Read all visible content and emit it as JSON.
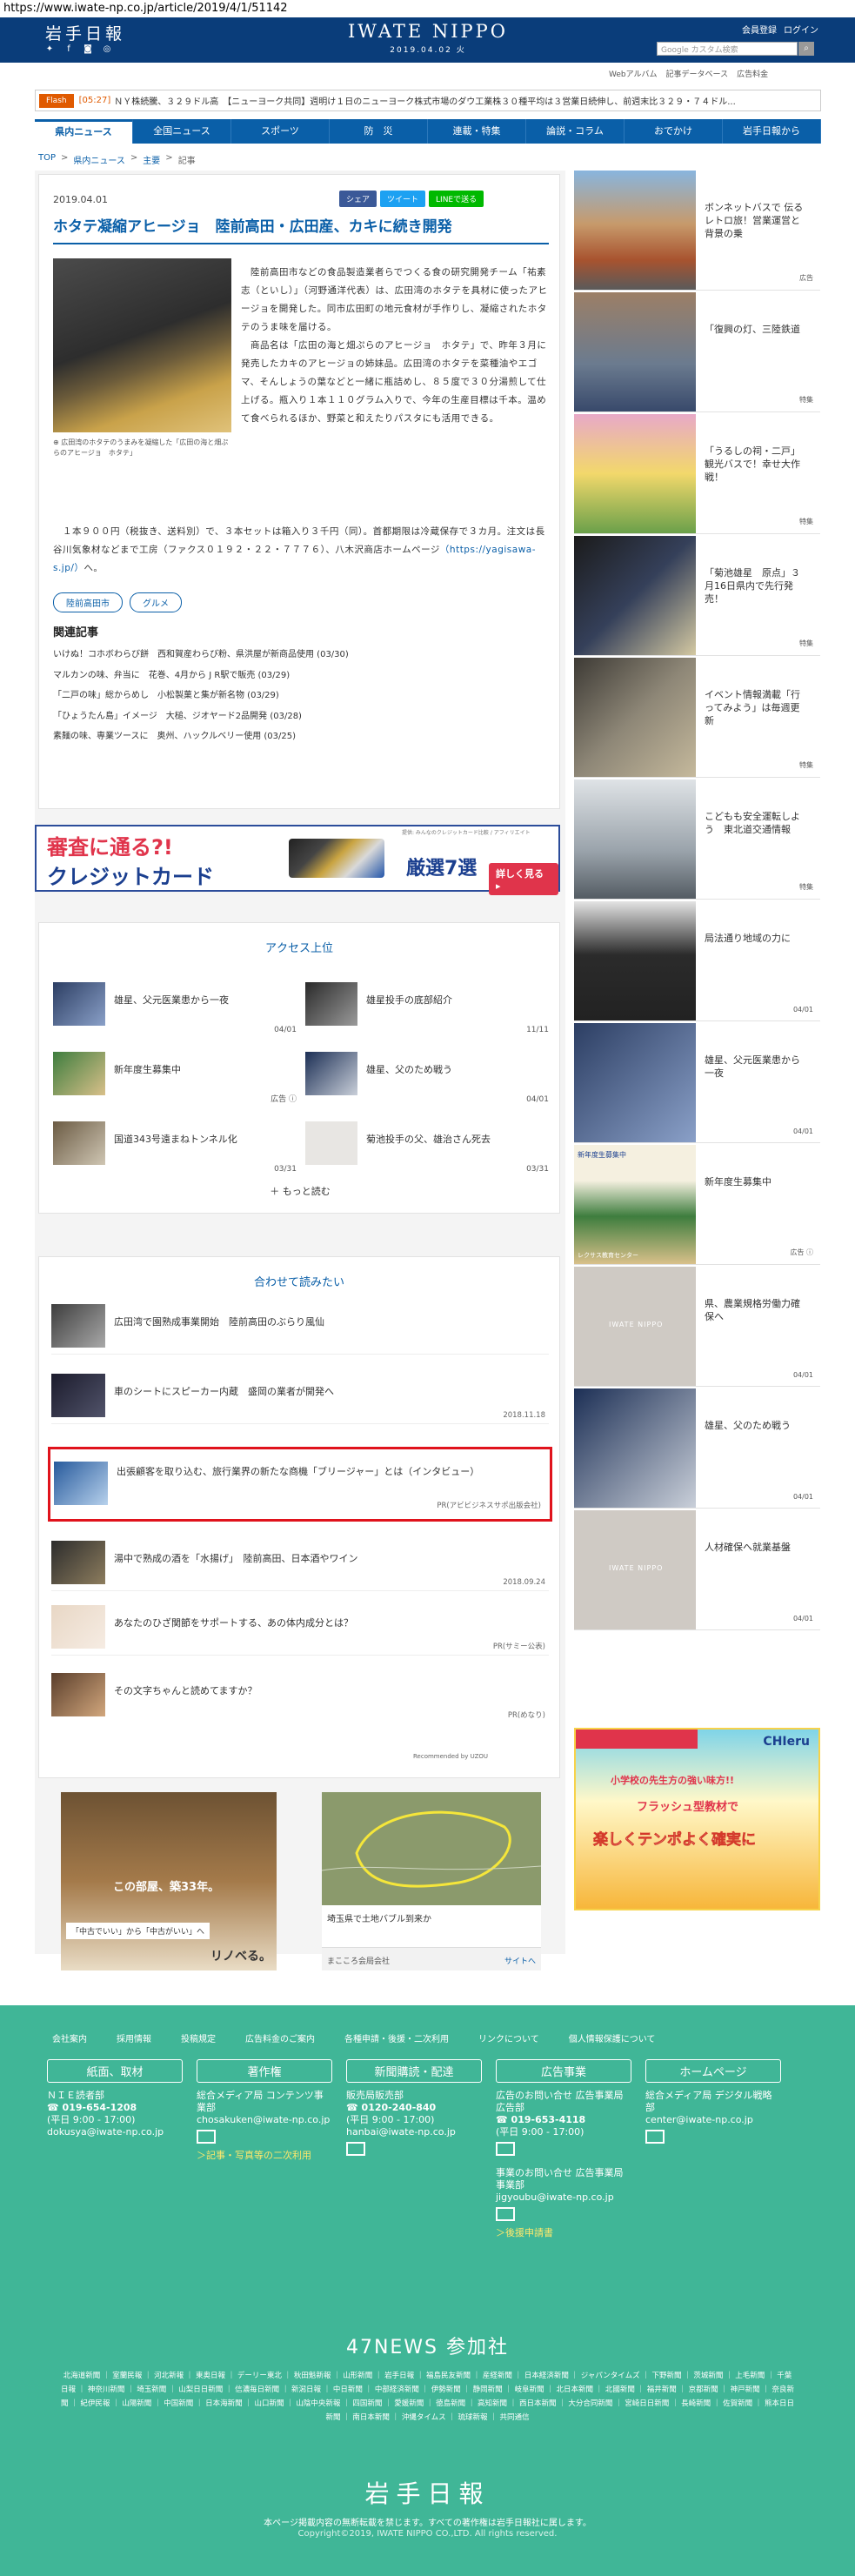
{
  "url": "https://www.iwate-np.co.jp/article/2019/4/1/51142",
  "header": {
    "logo_jp": "岩手日報",
    "brand": "IWATE NIPPO",
    "date": "2019.04.02 火",
    "links": [
      "会員登録",
      "ログイン"
    ],
    "search_placeholder": "Google カスタム検索",
    "social": [
      "twitter-icon",
      "facebook-icon",
      "line-icon",
      "instagram-icon"
    ]
  },
  "subnav": [
    "Webアルバム",
    "記事データベース",
    "広告料金"
  ],
  "ticker": {
    "label": "Flash",
    "time": "[05:27]",
    "text": "ＮＹ株続騰、３２９ドル高　【ニューヨーク共同】週明け１日のニューヨーク株式市場のダウ工業株３０種平均は３営業日続伸し、前週末比３２９・７４ドル..."
  },
  "nav": [
    "県内ニュース",
    "全国ニュース",
    "スポーツ",
    "防　災",
    "連載・特集",
    "論説・コラム",
    "おでかけ",
    "岩手日報から"
  ],
  "breadcrumb": [
    "TOP",
    "県内ニュース",
    "主要",
    "記事"
  ],
  "article": {
    "date": "2019.04.01",
    "share": [
      "シェア",
      "ツイート",
      "LINEで送る"
    ],
    "title": "ホタテ凝縮アヒージョ　陸前高田・広田産、カキに続き開発",
    "caption": "広田湾のホタテのうまみを凝縮した「広田の海と畑ぷらのアヒージョ　ホタテ」",
    "para1": "　陸前高田市などの食品製造業者らでつくる食の研究開発チーム「祐素志（といし）」（河野通洋代表）は、広田湾のホタテを具材に使ったアヒージョを開発した。同市広田町の地元食材が手作りし、凝縮されたホタテのうま味を届ける。",
    "para2": "　商品名は「広田の海と畑ぷらのアヒージョ　ホタテ」で、昨年３月に発売したカキのアヒージョの姉妹品。広田湾のホタテを菜種油やエゴマ、そんしょうの葉などと一緒に瓶詰めし、８５度で３０分湯煎して仕上げる。瓶入り１本１１０グラム入りで、今年の生産目標は千本。温めて食べられるほか、野菜と和えたりパスタにも活用できる。",
    "para3": "　１本９００円（税抜き、送料別）で、３本セットは箱入り３千円（同）。首都期限は冷蔵保存で３カ月。注文は長谷川気象材などまで工房（ファクス０１９２・２２・７７７６）、八木沢商店ホームページ",
    "link": "（https://yagisawa-s.jp/）",
    "para3_end": "へ。",
    "tags": [
      "陸前高田市",
      "グルメ"
    ],
    "related_heading": "関連記事",
    "related": [
      "いけぬ！コホボわらび餅　西和賀産わらび粉、県洪屋が新商品使用 (03/30)",
      "マルカンの味、弁当に　花巻、4月から J R駅で販売 (03/29)",
      "「二戸の味」総からめし　小松製菓と集が新名物 (03/29)",
      "「ひょうたん島」イメージ　大槌、ジオヤード2品開発 (03/28)",
      "素麺の味、専業ツースに　奥州、ハックルベリー使用 (03/25)"
    ]
  },
  "banner_ad": {
    "top": "提供: みんなのクレジットカード比較 / アフィリエイト",
    "line1": "審査に通る?!",
    "line2": "クレジットカード",
    "highlight": "厳選7選",
    "button": "詳しく見る ▸"
  },
  "ranking": {
    "title": "アクセス上位",
    "items": [
      {
        "text": "雄星、父元医業患から一夜",
        "date": "04/01"
      },
      {
        "text": "雄星投手の底部紹介",
        "date": "11/11"
      },
      {
        "text": "新年度生募集中",
        "date": "広告 ⓘ"
      },
      {
        "text": "雄星、父のため戦う",
        "date": "04/01"
      },
      {
        "text": "国道343号遠まねトンネル化",
        "date": "03/31"
      },
      {
        "text": "菊池投手の父、雄治さん死去",
        "date": "03/31"
      }
    ],
    "more": "もっと読む"
  },
  "reco": {
    "title": "合わせて読みたい",
    "items": [
      {
        "text": "広田湾で園熟成事業開始　陸前高田のぶらり風仙",
        "meta": ""
      },
      {
        "text": "車のシートにスピーカー内蔵　盛岡の業者が開発へ",
        "meta": "2018.11.18"
      },
      {
        "text": "出張顧客を取り込む、旅行業界の新たな商機「ブリージャー」とは（インタビュー）",
        "meta": "PR(アビビジネスサポ出版会社)"
      },
      {
        "text": "湯中で熟成の酒を「水揚げ」　陸前高田、日本酒やワイン",
        "meta": "2018.09.24"
      },
      {
        "text": "あなたのひざ関節をサポートする、あの体内成分とは？",
        "meta": "PR(サミー公表)"
      },
      {
        "text": "その文字ちゃんと読めてますか？",
        "meta": "PR(めなり)"
      }
    ],
    "recommended": "Recommended by UZOU"
  },
  "bottom_ads": {
    "left_title": "この部屋、築33年。",
    "left_sub": "「中古でいい」から「中古がいい」へ",
    "left_brand": "リノベる。",
    "right_caption": "埼玉県で土地バブル到来か",
    "right_source": "まこころ会局会社",
    "right_link": "サイトへ"
  },
  "sidebar": {
    "items": [
      {
        "text": "ボンネットバスで 伝るレトロ旅！営業運営と背景の乗",
        "meta": "広告"
      },
      {
        "text": "「復興の灯、三陸鉄道",
        "meta": "特集"
      },
      {
        "text": "「うるしの祠・二戸」観光バスで！幸せ大作戦！",
        "meta": "特集"
      },
      {
        "text": "「菊池雄星　原点」３月16日県内で先行発売！",
        "meta": "特集"
      },
      {
        "text": "イベント情報満載「行ってみよう」は毎週更新",
        "meta": "特集"
      },
      {
        "text": "こどもも安全運転しよう　東北道交通情報",
        "meta": "特集"
      },
      {
        "text": "局法通り地域の力に",
        "meta": "04/01"
      },
      {
        "text": "雄星、父元医業患から一夜",
        "meta": "04/01"
      },
      {
        "text": "新年度生募集中",
        "meta": "広告 ⓘ"
      },
      {
        "text": "県、農業規格労働力確保へ",
        "meta": "04/01"
      },
      {
        "text": "雄星、父のため戦う",
        "meta": "04/01"
      },
      {
        "text": "人材確保へ就業基盤",
        "meta": "04/01"
      }
    ],
    "iwate_label": "IWATE NIPPO",
    "ad_text1": "小学校の先生方の強い味方!!",
    "ad_text2": "フラッシュ型教材で",
    "ad_text3": "楽しくテンポよく確実に",
    "ad_brand": "CHIeru",
    "side_badge": "レクサス教育センター",
    "side_badge_title": "新年度生募集中"
  },
  "footer": {
    "links": [
      "会社案内",
      "採用情報",
      "投稿規定",
      "広告料金のご案内",
      "各種申請・後援・二次利用",
      "リンクについて",
      "個人情報保護について"
    ],
    "cols": [
      {
        "head": "紙面、取材",
        "sub": "ＮＩＥ読者部",
        "phone": "019-654-1208",
        "hours": "(平日 9:00 - 17:00)",
        "mail": "dokusya@iwate-np.co.jp",
        "link": ""
      },
      {
        "head": "著作権",
        "sub": "総合メディア局 コンテンツ事業部",
        "phone": "",
        "hours": "",
        "mail": "chosakuken@iwate-np.co.jp",
        "link": "＞記事・写真等の二次利用"
      },
      {
        "head": "新聞購読・配達",
        "sub": "販売局販売部",
        "phone": "0120-240-840",
        "hours": "(平日 9:00 - 17:00)",
        "mail": "hanbai@iwate-np.co.jp",
        "link": ""
      },
      {
        "head": "広告事業",
        "sub": "広告のお問い合せ 広告事業局広告部",
        "phone": "019-653-4118",
        "hours": "(平日 9:00 - 17:00)",
        "mail": "",
        "link": "",
        "sub2": "事業のお問い合せ 広告事業局事業部",
        "mail2": "jigyoubu@iwate-np.co.jp",
        "link2": "＞後援申請書"
      },
      {
        "head": "ホームページ",
        "sub": "総合メディア局 デジタル戦略部",
        "phone": "",
        "hours": "",
        "mail": "center@iwate-np.co.jp",
        "link": ""
      }
    ],
    "n47_title": "47NEWS 参加社",
    "n47_list": "北海道新聞 ｜ 室蘭民報 ｜ 河北新報 ｜ 東奥日報 ｜ デーリー東北 ｜ 秋田魁新報 ｜ 山形新聞 ｜ 岩手日報 ｜ 福島民友新聞 ｜ 産経新聞 ｜ 日本経済新聞 ｜ ジャパンタイムズ ｜ 下野新聞 ｜ 茨城新聞 ｜ 上毛新聞 ｜ 千葉日報 ｜ 神奈川新聞 ｜ 埼玉新聞 ｜ 山梨日日新聞 ｜ 信濃毎日新聞 ｜ 新潟日報 ｜ 中日新聞 ｜ 中部経済新聞 ｜ 伊勢新聞 ｜ 静岡新聞 ｜ 岐阜新聞 ｜ 北日本新聞 ｜ 北國新聞 ｜ 福井新聞 ｜ 京都新聞 ｜ 神戸新聞 ｜ 奈良新聞 ｜ 紀伊民報 ｜ 山陽新聞 ｜ 中国新聞 ｜ 日本海新聞 ｜ 山口新聞 ｜ 山陰中央新報 ｜ 四国新聞 ｜ 愛媛新聞 ｜ 徳島新聞 ｜ 高知新聞 ｜ 西日本新聞 ｜ 大分合同新聞 ｜ 宮崎日日新聞 ｜ 長崎新聞 ｜ 佐賀新聞 ｜ 熊本日日新聞 ｜ 南日本新聞 ｜ 沖縄タイムス ｜ 琉球新報 ｜ 共同通信",
    "logo": "岩手日報",
    "copy1": "本ページ掲載内容の無断転載を禁じます。すべての著作権は岩手日報社に属します。",
    "copy2": "Copyright©2019, IWATE NIPPO CO.,LTD. All rights reserved."
  },
  "colors": {
    "brand_blue": "#0a5fa8",
    "header_navy": "#0a3d7a",
    "footer_green": "#40b697",
    "highlight_red": "#e0131c"
  }
}
